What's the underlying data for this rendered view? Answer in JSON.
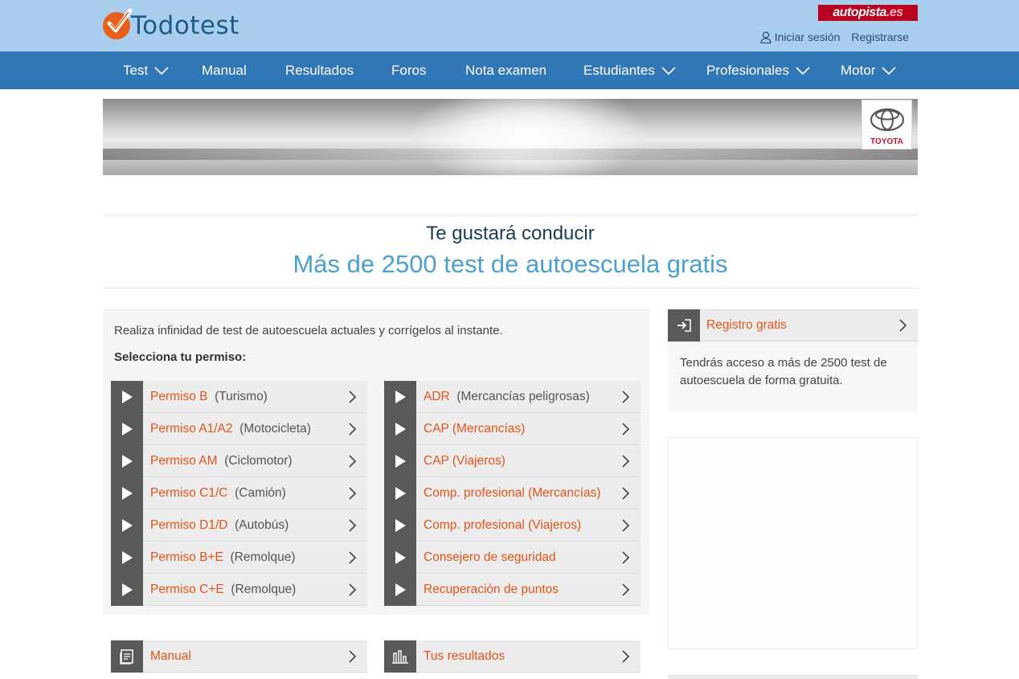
{
  "brand": {
    "logo_text": "Todotest",
    "partner_main": "autopista",
    "partner_suffix": ".es"
  },
  "account": {
    "login_label": "Iniciar sesión",
    "register_label": "Registrarse"
  },
  "nav": [
    {
      "label": "Test",
      "dropdown": true
    },
    {
      "label": "Manual",
      "dropdown": false
    },
    {
      "label": "Resultados",
      "dropdown": false
    },
    {
      "label": "Foros",
      "dropdown": false
    },
    {
      "label": "Nota examen",
      "dropdown": false
    },
    {
      "label": "Estudiantes",
      "dropdown": true
    },
    {
      "label": "Profesionales",
      "dropdown": true
    },
    {
      "label": "Motor",
      "dropdown": true
    }
  ],
  "banner": {
    "sponsor": "TOYOTA"
  },
  "headline": {
    "subtitle": "Te gustará conducir",
    "title": "Más de 2500 test de autoescuela gratis"
  },
  "permits": {
    "intro": "Realiza infinidad de test de autoescuela actuales y corrígelos al instante.",
    "choose": "Selecciona tu permiso:",
    "left": [
      {
        "name": "Permiso B",
        "desc": "(Turismo)"
      },
      {
        "name": "Permiso A1/A2",
        "desc": "(Motocicleta)"
      },
      {
        "name": "Permiso AM",
        "desc": "(Ciclomotor)"
      },
      {
        "name": "Permiso C1/C",
        "desc": "(Camión)"
      },
      {
        "name": "Permiso D1/D",
        "desc": "(Autobús)"
      },
      {
        "name": "Permiso B+E",
        "desc": "(Remolque)"
      },
      {
        "name": "Permiso C+E",
        "desc": "(Remolque)"
      }
    ],
    "right": [
      {
        "name": "ADR",
        "desc": "(Mercancías peligrosas)"
      },
      {
        "name": "CAP (Mercancías)",
        "desc": ""
      },
      {
        "name": "CAP (Viajeros)",
        "desc": ""
      },
      {
        "name": "Comp. profesional (Mercancías)",
        "desc": ""
      },
      {
        "name": "Comp. profesional (Viajeros)",
        "desc": ""
      },
      {
        "name": "Consejero de seguridad",
        "desc": ""
      },
      {
        "name": "Recuperación de puntos",
        "desc": ""
      }
    ]
  },
  "tiles": {
    "manual": "Manual",
    "results": "Tus resultados"
  },
  "register": {
    "label": "Registro gratis",
    "text": "Tendrás acceso a más de 2500 test de autoescuela de forma gratuita."
  },
  "colors": {
    "header_bg": "#a9cdec",
    "nav_bg": "#3277b5",
    "accent": "#e2541a",
    "headline": "#4aa0d1"
  }
}
